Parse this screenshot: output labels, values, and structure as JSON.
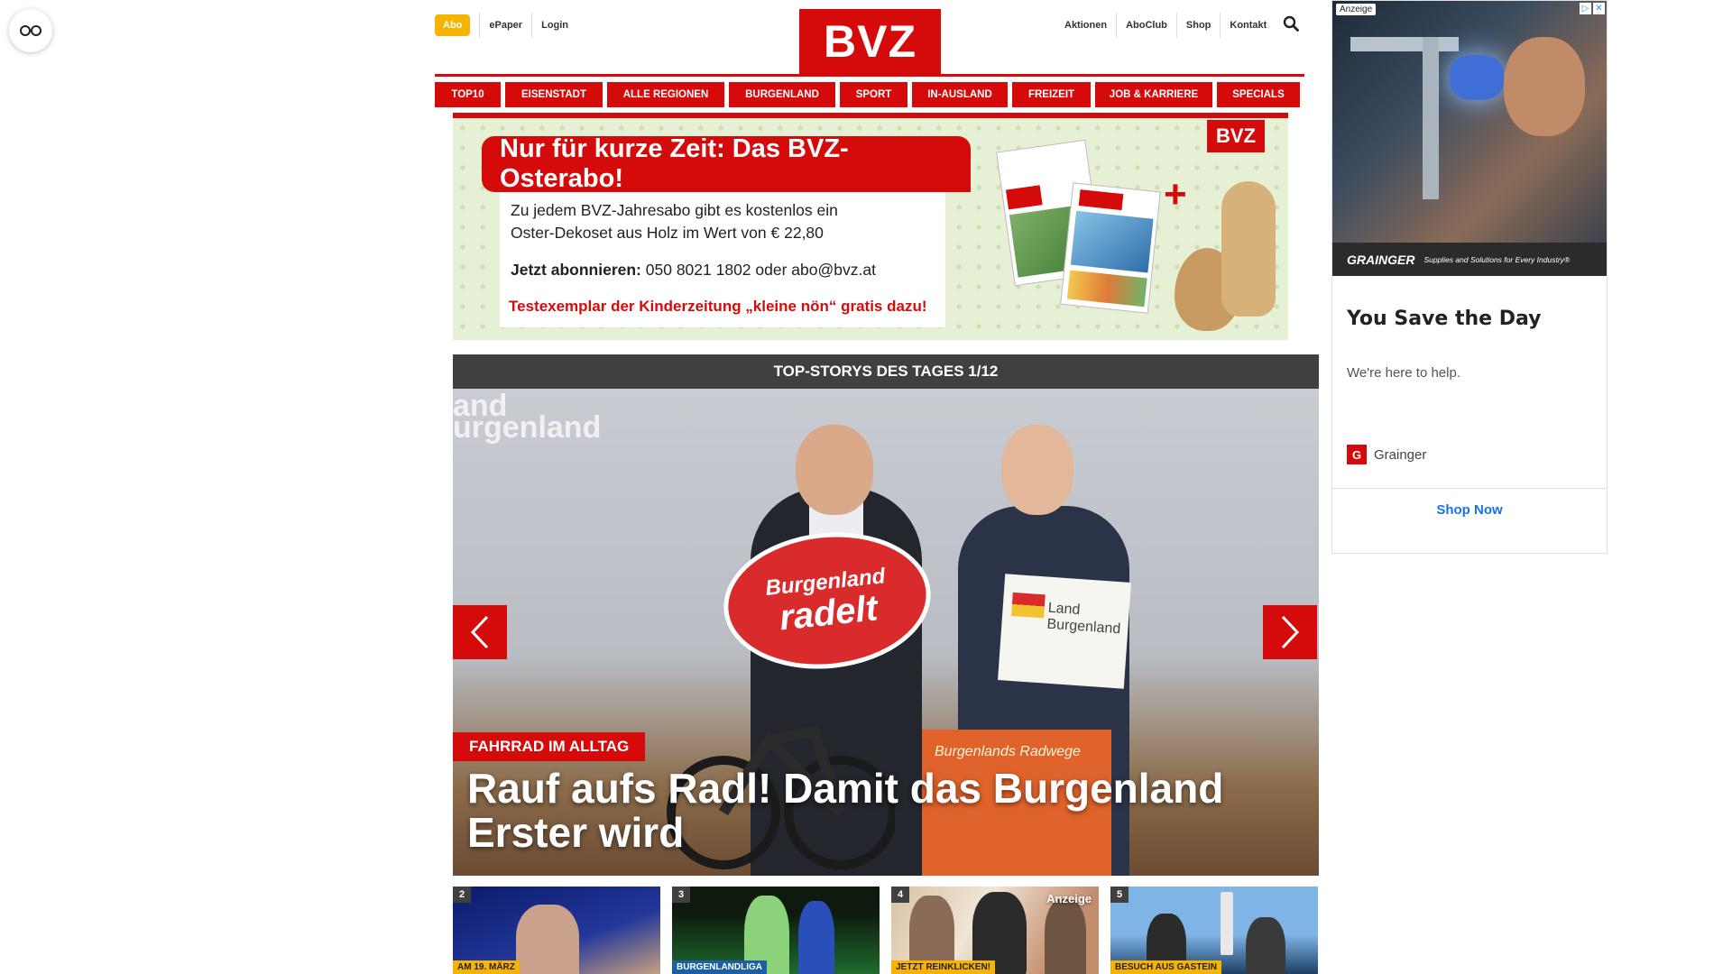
{
  "float_button": {
    "icon": "glasses-icon"
  },
  "header": {
    "abo_label": "Abo",
    "left_links": [
      "ePaper",
      "Login"
    ],
    "logo_text": "BVZ",
    "right_links": [
      "Aktionen",
      "AboClub",
      "Shop",
      "Kontakt"
    ],
    "search_icon": "search-icon"
  },
  "nav": {
    "items": [
      "TOP10",
      "EISENSTADT",
      "ALLE REGIONEN",
      "BURGENLAND",
      "SPORT",
      "IN-AUSLAND",
      "FREIZEIT",
      "JOB & KARRIERE",
      "SPECIALS"
    ]
  },
  "promo": {
    "headline": "Nur für kurze Zeit: Das BVZ-Osterabo!",
    "line1": "Zu jedem BVZ-Jahresabo gibt es kostenlos ein",
    "line2": "Oster-Dekoset aus Holz im Wert von € 22,80",
    "cta_bold": "Jetzt abonnieren:",
    "cta_rest": " 050 8021 1802 oder abo@bvz.at",
    "red_line": "Testexemplar der Kinderzeitung „kleine nön“ gratis dazu!",
    "logo": "BVZ",
    "plus": "+"
  },
  "top_stories": {
    "bar_label": "TOP-STORYS DES TAGES 1/12",
    "hero_bg_text_1": "and",
    "hero_bg_text_2": "urgenland",
    "sign_line1": "Burgenland",
    "sign_line2": "radelt",
    "white_sign_text": "Land Burgenland",
    "orange_panel_text": "Burgenlands Radwege",
    "kicker": "FAHRRAD IM ALLTAG",
    "title": "Rauf aufs Radl! Damit das Burgenland Erster wird"
  },
  "thumbnails": [
    {
      "num": "2",
      "tag": "AM 19. MÄRZ",
      "tag_style": "yellow"
    },
    {
      "num": "3",
      "tag": "BURGENLANDLIGA",
      "tag_style": "blue"
    },
    {
      "num": "4",
      "tag": "JETZT REINKLICKEN!",
      "tag_style": "yellow",
      "ad": "Anzeige"
    },
    {
      "num": "5",
      "tag": "BESUCH AUS GASTEIN",
      "tag_style": "yellow"
    }
  ],
  "ad": {
    "label": "Anzeige",
    "brand_band": "GRAINGER",
    "slogan": "Supplies and Solutions for Every Industry®",
    "title": "You Save the Day",
    "description": "We're here to help.",
    "brand_icon_letter": "G",
    "brand_name": "Grainger",
    "cta": "Shop Now"
  },
  "colors": {
    "brand_red": "#d50b0b",
    "abo_yellow": "#f6b400",
    "bar_grey": "#404040",
    "link_blue": "#1a73e8"
  }
}
